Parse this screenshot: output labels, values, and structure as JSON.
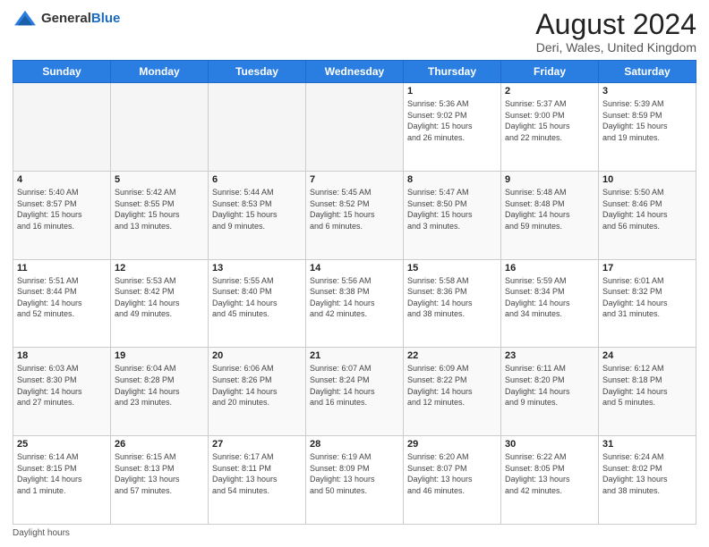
{
  "header": {
    "logo": {
      "general": "General",
      "blue": "Blue"
    },
    "title": "August 2024",
    "subtitle": "Deri, Wales, United Kingdom"
  },
  "days_of_week": [
    "Sunday",
    "Monday",
    "Tuesday",
    "Wednesday",
    "Thursday",
    "Friday",
    "Saturday"
  ],
  "weeks": [
    [
      {
        "day": "",
        "info": ""
      },
      {
        "day": "",
        "info": ""
      },
      {
        "day": "",
        "info": ""
      },
      {
        "day": "",
        "info": ""
      },
      {
        "day": "1",
        "info": "Sunrise: 5:36 AM\nSunset: 9:02 PM\nDaylight: 15 hours\nand 26 minutes."
      },
      {
        "day": "2",
        "info": "Sunrise: 5:37 AM\nSunset: 9:00 PM\nDaylight: 15 hours\nand 22 minutes."
      },
      {
        "day": "3",
        "info": "Sunrise: 5:39 AM\nSunset: 8:59 PM\nDaylight: 15 hours\nand 19 minutes."
      }
    ],
    [
      {
        "day": "4",
        "info": "Sunrise: 5:40 AM\nSunset: 8:57 PM\nDaylight: 15 hours\nand 16 minutes."
      },
      {
        "day": "5",
        "info": "Sunrise: 5:42 AM\nSunset: 8:55 PM\nDaylight: 15 hours\nand 13 minutes."
      },
      {
        "day": "6",
        "info": "Sunrise: 5:44 AM\nSunset: 8:53 PM\nDaylight: 15 hours\nand 9 minutes."
      },
      {
        "day": "7",
        "info": "Sunrise: 5:45 AM\nSunset: 8:52 PM\nDaylight: 15 hours\nand 6 minutes."
      },
      {
        "day": "8",
        "info": "Sunrise: 5:47 AM\nSunset: 8:50 PM\nDaylight: 15 hours\nand 3 minutes."
      },
      {
        "day": "9",
        "info": "Sunrise: 5:48 AM\nSunset: 8:48 PM\nDaylight: 14 hours\nand 59 minutes."
      },
      {
        "day": "10",
        "info": "Sunrise: 5:50 AM\nSunset: 8:46 PM\nDaylight: 14 hours\nand 56 minutes."
      }
    ],
    [
      {
        "day": "11",
        "info": "Sunrise: 5:51 AM\nSunset: 8:44 PM\nDaylight: 14 hours\nand 52 minutes."
      },
      {
        "day": "12",
        "info": "Sunrise: 5:53 AM\nSunset: 8:42 PM\nDaylight: 14 hours\nand 49 minutes."
      },
      {
        "day": "13",
        "info": "Sunrise: 5:55 AM\nSunset: 8:40 PM\nDaylight: 14 hours\nand 45 minutes."
      },
      {
        "day": "14",
        "info": "Sunrise: 5:56 AM\nSunset: 8:38 PM\nDaylight: 14 hours\nand 42 minutes."
      },
      {
        "day": "15",
        "info": "Sunrise: 5:58 AM\nSunset: 8:36 PM\nDaylight: 14 hours\nand 38 minutes."
      },
      {
        "day": "16",
        "info": "Sunrise: 5:59 AM\nSunset: 8:34 PM\nDaylight: 14 hours\nand 34 minutes."
      },
      {
        "day": "17",
        "info": "Sunrise: 6:01 AM\nSunset: 8:32 PM\nDaylight: 14 hours\nand 31 minutes."
      }
    ],
    [
      {
        "day": "18",
        "info": "Sunrise: 6:03 AM\nSunset: 8:30 PM\nDaylight: 14 hours\nand 27 minutes."
      },
      {
        "day": "19",
        "info": "Sunrise: 6:04 AM\nSunset: 8:28 PM\nDaylight: 14 hours\nand 23 minutes."
      },
      {
        "day": "20",
        "info": "Sunrise: 6:06 AM\nSunset: 8:26 PM\nDaylight: 14 hours\nand 20 minutes."
      },
      {
        "day": "21",
        "info": "Sunrise: 6:07 AM\nSunset: 8:24 PM\nDaylight: 14 hours\nand 16 minutes."
      },
      {
        "day": "22",
        "info": "Sunrise: 6:09 AM\nSunset: 8:22 PM\nDaylight: 14 hours\nand 12 minutes."
      },
      {
        "day": "23",
        "info": "Sunrise: 6:11 AM\nSunset: 8:20 PM\nDaylight: 14 hours\nand 9 minutes."
      },
      {
        "day": "24",
        "info": "Sunrise: 6:12 AM\nSunset: 8:18 PM\nDaylight: 14 hours\nand 5 minutes."
      }
    ],
    [
      {
        "day": "25",
        "info": "Sunrise: 6:14 AM\nSunset: 8:15 PM\nDaylight: 14 hours\nand 1 minute."
      },
      {
        "day": "26",
        "info": "Sunrise: 6:15 AM\nSunset: 8:13 PM\nDaylight: 13 hours\nand 57 minutes."
      },
      {
        "day": "27",
        "info": "Sunrise: 6:17 AM\nSunset: 8:11 PM\nDaylight: 13 hours\nand 54 minutes."
      },
      {
        "day": "28",
        "info": "Sunrise: 6:19 AM\nSunset: 8:09 PM\nDaylight: 13 hours\nand 50 minutes."
      },
      {
        "day": "29",
        "info": "Sunrise: 6:20 AM\nSunset: 8:07 PM\nDaylight: 13 hours\nand 46 minutes."
      },
      {
        "day": "30",
        "info": "Sunrise: 6:22 AM\nSunset: 8:05 PM\nDaylight: 13 hours\nand 42 minutes."
      },
      {
        "day": "31",
        "info": "Sunrise: 6:24 AM\nSunset: 8:02 PM\nDaylight: 13 hours\nand 38 minutes."
      }
    ]
  ],
  "footer": "Daylight hours"
}
